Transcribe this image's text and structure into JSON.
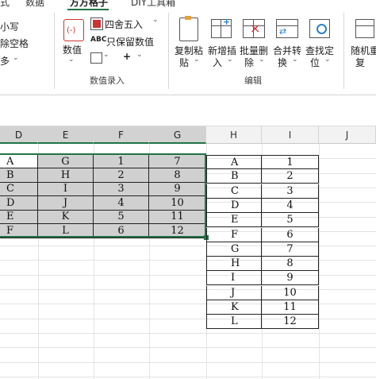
{
  "ribbon": {
    "tabs": [
      "式",
      "数据",
      "方方格子",
      "DIY工具箱"
    ],
    "left_items": [
      "小写",
      "除空格",
      "多"
    ],
    "numeric_button": "数值",
    "round_label": "四舍五入",
    "keep_value_label": "只保留数值",
    "plus_label": "+",
    "numeric_group_label": "数值录入",
    "copy_paste": [
      "复制粘",
      "贴"
    ],
    "insert_new": [
      "新增插",
      "入"
    ],
    "batch_delete": [
      "批量删",
      "除"
    ],
    "merge_convert": [
      "合并转",
      "换"
    ],
    "find_locate": [
      "查找定",
      "位"
    ],
    "edit_group_label": "编辑",
    "random_repeat": [
      "随机重",
      "复"
    ]
  },
  "sheet": {
    "columns": [
      "D",
      "E",
      "F",
      "G",
      "H",
      "I",
      "J"
    ],
    "selected_columns": [
      "D",
      "E",
      "F",
      "G"
    ],
    "left_table": [
      [
        "A",
        "G",
        "1",
        "7"
      ],
      [
        "B",
        "H",
        "2",
        "8"
      ],
      [
        "C",
        "I",
        "3",
        "9"
      ],
      [
        "D",
        "J",
        "4",
        "10"
      ],
      [
        "E",
        "K",
        "5",
        "11"
      ],
      [
        "F",
        "L",
        "6",
        "12"
      ]
    ],
    "right_table": [
      [
        "A",
        "1"
      ],
      [
        "B",
        "2"
      ],
      [
        "C",
        "3"
      ],
      [
        "D",
        "4"
      ],
      [
        "E",
        "5"
      ],
      [
        "F",
        "6"
      ],
      [
        "G",
        "7"
      ],
      [
        "H",
        "8"
      ],
      [
        "I",
        "9"
      ],
      [
        "J",
        "10"
      ],
      [
        "K",
        "11"
      ],
      [
        "L",
        "12"
      ]
    ]
  },
  "colors": {
    "accent": "#217346",
    "selection_fill": "#d0d0d0",
    "header_fill": "#f2f2f2"
  }
}
